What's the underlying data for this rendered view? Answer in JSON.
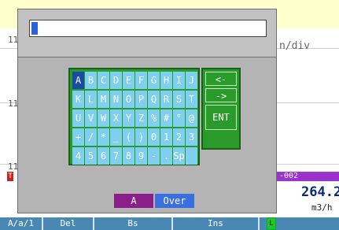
{
  "background": {
    "top_bg": "#ffffcc",
    "axis_labels": [
      "11",
      "11",
      "11"
    ],
    "div_label": "n/div",
    "channel_tag": "-002",
    "red_marker": "T",
    "reading_value": "264.2",
    "reading_unit": "m3/h",
    "bottom_keys": [
      "A/a/1",
      "Del",
      "Bs",
      "Ins"
    ],
    "green_indicator": "L"
  },
  "dialog": {
    "input_value": "",
    "keys": [
      [
        "A",
        "B",
        "C",
        "D",
        "E",
        "F",
        "G",
        "H",
        "I",
        "J"
      ],
      [
        "K",
        "L",
        "M",
        "N",
        "O",
        "P",
        "Q",
        "R",
        "S",
        "T"
      ],
      [
        "U",
        "V",
        "W",
        "X",
        "Y",
        "Z",
        "%",
        "#",
        "°",
        "@"
      ],
      [
        "+",
        "/",
        "*",
        "_",
        "(",
        ")",
        "0",
        "1",
        "2",
        "3"
      ],
      [
        "4",
        "5",
        "6",
        "7",
        "8",
        "9",
        "-",
        ".",
        "Sp",
        ""
      ]
    ],
    "selected_key": "A",
    "side_keys": [
      "<-",
      "->",
      "ENT"
    ],
    "mode_case": "A",
    "mode_insert": "Over"
  }
}
